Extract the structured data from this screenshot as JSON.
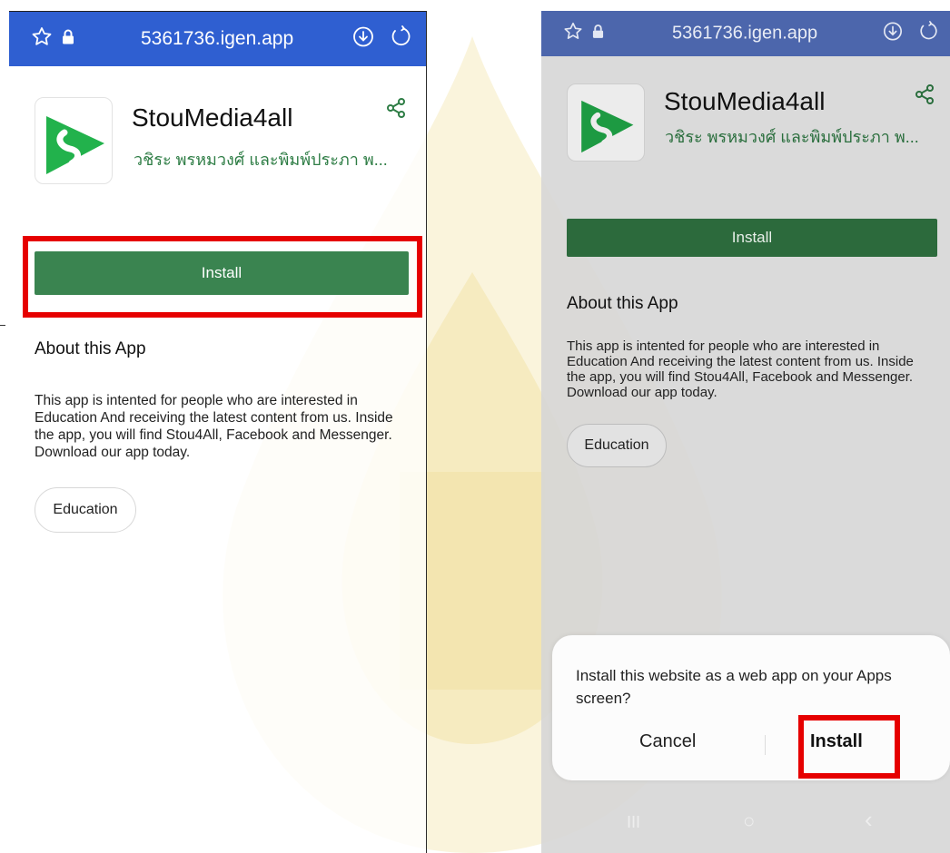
{
  "browser": {
    "url": "5361736.igen.app"
  },
  "app": {
    "name": "StouMedia4all",
    "developer": "วชิระ พรหมวงศ์ และพิมพ์ประภา พ...",
    "install_label": "Install",
    "about_title": "About this App",
    "description": "This app is intented for people who are interested in Education And receiving the latest content from us. Inside the app, you will find Stou4All, Facebook and Messenger. Download our app today.",
    "category_tag": "Education"
  },
  "dialog": {
    "message": "Install this website as a web app on your Apps screen?",
    "cancel_label": "Cancel",
    "install_label": "Install"
  },
  "navbar": {
    "recent_glyph": "III",
    "home_glyph": "○",
    "back_glyph": "‹"
  },
  "colors": {
    "browser_bar": "#2f5fd1",
    "install_button": "#3a8450",
    "developer_text": "#2e7d45",
    "highlight": "#e60000",
    "watermark": "#f5e7b2"
  },
  "icons": [
    "star-icon",
    "lock-icon",
    "download-icon",
    "reload-icon",
    "share-icon",
    "app-logo-icon"
  ]
}
